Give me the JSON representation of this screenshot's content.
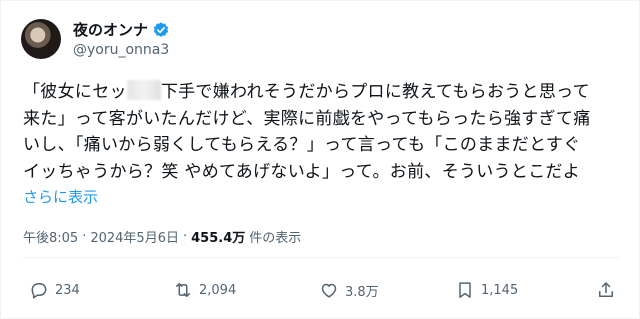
{
  "author": {
    "display_name": "夜のオンナ",
    "handle": "@yoru_onna3",
    "verified_color": "#1d9bf0"
  },
  "tweet": {
    "lines": [
      {
        "before": "「彼女にセッ",
        "after": "下手で嫌われそうだからプロに教えてもらおうと思って"
      },
      {
        "text": "来た」って客がいたんだけど、実際に前戯をやってもらったら強すぎて痛"
      },
      {
        "text": "いし、「痛いから弱くしてもらえる？」って言っても「このままだとすぐ"
      },
      {
        "text": "イッちゃうから？笑 やめてあげないよ」って。お前、そういうとこだよ"
      }
    ],
    "show_more": "さらに表示"
  },
  "meta": {
    "time": "午後8:05",
    "separator1": "·",
    "date": "2024年5月6日",
    "separator2": "·",
    "views_count": "455.4万",
    "views_label": "件の表示"
  },
  "actions": {
    "reply_count": "234",
    "retweet_count": "2,094",
    "like_count": "3.8万",
    "bookmark_count": "1,145"
  },
  "icons": {
    "reply": "reply-icon",
    "retweet": "retweet-icon",
    "like": "heart-icon",
    "bookmark": "bookmark-icon",
    "share": "share-icon",
    "verified": "verified-badge-icon"
  }
}
